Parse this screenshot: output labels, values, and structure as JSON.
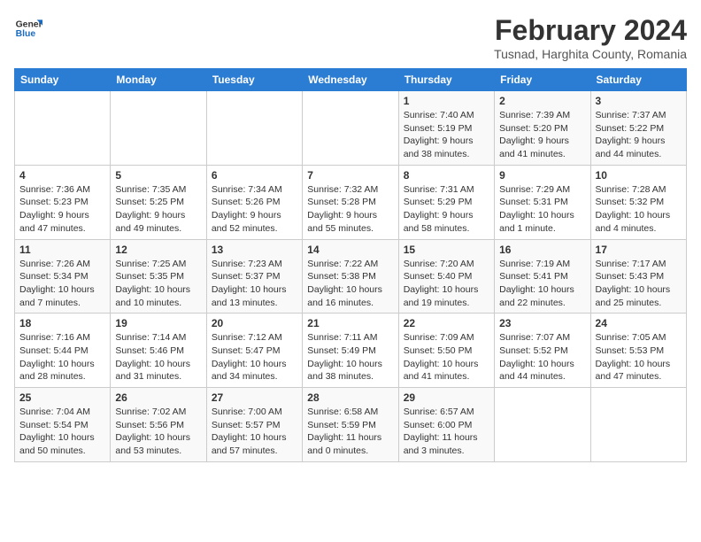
{
  "header": {
    "logo_line1": "General",
    "logo_line2": "Blue",
    "title": "February 2024",
    "subtitle": "Tusnad, Harghita County, Romania"
  },
  "weekdays": [
    "Sunday",
    "Monday",
    "Tuesday",
    "Wednesday",
    "Thursday",
    "Friday",
    "Saturday"
  ],
  "weeks": [
    [
      {
        "day": "",
        "info": ""
      },
      {
        "day": "",
        "info": ""
      },
      {
        "day": "",
        "info": ""
      },
      {
        "day": "",
        "info": ""
      },
      {
        "day": "1",
        "info": "Sunrise: 7:40 AM\nSunset: 5:19 PM\nDaylight: 9 hours\nand 38 minutes."
      },
      {
        "day": "2",
        "info": "Sunrise: 7:39 AM\nSunset: 5:20 PM\nDaylight: 9 hours\nand 41 minutes."
      },
      {
        "day": "3",
        "info": "Sunrise: 7:37 AM\nSunset: 5:22 PM\nDaylight: 9 hours\nand 44 minutes."
      }
    ],
    [
      {
        "day": "4",
        "info": "Sunrise: 7:36 AM\nSunset: 5:23 PM\nDaylight: 9 hours\nand 47 minutes."
      },
      {
        "day": "5",
        "info": "Sunrise: 7:35 AM\nSunset: 5:25 PM\nDaylight: 9 hours\nand 49 minutes."
      },
      {
        "day": "6",
        "info": "Sunrise: 7:34 AM\nSunset: 5:26 PM\nDaylight: 9 hours\nand 52 minutes."
      },
      {
        "day": "7",
        "info": "Sunrise: 7:32 AM\nSunset: 5:28 PM\nDaylight: 9 hours\nand 55 minutes."
      },
      {
        "day": "8",
        "info": "Sunrise: 7:31 AM\nSunset: 5:29 PM\nDaylight: 9 hours\nand 58 minutes."
      },
      {
        "day": "9",
        "info": "Sunrise: 7:29 AM\nSunset: 5:31 PM\nDaylight: 10 hours\nand 1 minute."
      },
      {
        "day": "10",
        "info": "Sunrise: 7:28 AM\nSunset: 5:32 PM\nDaylight: 10 hours\nand 4 minutes."
      }
    ],
    [
      {
        "day": "11",
        "info": "Sunrise: 7:26 AM\nSunset: 5:34 PM\nDaylight: 10 hours\nand 7 minutes."
      },
      {
        "day": "12",
        "info": "Sunrise: 7:25 AM\nSunset: 5:35 PM\nDaylight: 10 hours\nand 10 minutes."
      },
      {
        "day": "13",
        "info": "Sunrise: 7:23 AM\nSunset: 5:37 PM\nDaylight: 10 hours\nand 13 minutes."
      },
      {
        "day": "14",
        "info": "Sunrise: 7:22 AM\nSunset: 5:38 PM\nDaylight: 10 hours\nand 16 minutes."
      },
      {
        "day": "15",
        "info": "Sunrise: 7:20 AM\nSunset: 5:40 PM\nDaylight: 10 hours\nand 19 minutes."
      },
      {
        "day": "16",
        "info": "Sunrise: 7:19 AM\nSunset: 5:41 PM\nDaylight: 10 hours\nand 22 minutes."
      },
      {
        "day": "17",
        "info": "Sunrise: 7:17 AM\nSunset: 5:43 PM\nDaylight: 10 hours\nand 25 minutes."
      }
    ],
    [
      {
        "day": "18",
        "info": "Sunrise: 7:16 AM\nSunset: 5:44 PM\nDaylight: 10 hours\nand 28 minutes."
      },
      {
        "day": "19",
        "info": "Sunrise: 7:14 AM\nSunset: 5:46 PM\nDaylight: 10 hours\nand 31 minutes."
      },
      {
        "day": "20",
        "info": "Sunrise: 7:12 AM\nSunset: 5:47 PM\nDaylight: 10 hours\nand 34 minutes."
      },
      {
        "day": "21",
        "info": "Sunrise: 7:11 AM\nSunset: 5:49 PM\nDaylight: 10 hours\nand 38 minutes."
      },
      {
        "day": "22",
        "info": "Sunrise: 7:09 AM\nSunset: 5:50 PM\nDaylight: 10 hours\nand 41 minutes."
      },
      {
        "day": "23",
        "info": "Sunrise: 7:07 AM\nSunset: 5:52 PM\nDaylight: 10 hours\nand 44 minutes."
      },
      {
        "day": "24",
        "info": "Sunrise: 7:05 AM\nSunset: 5:53 PM\nDaylight: 10 hours\nand 47 minutes."
      }
    ],
    [
      {
        "day": "25",
        "info": "Sunrise: 7:04 AM\nSunset: 5:54 PM\nDaylight: 10 hours\nand 50 minutes."
      },
      {
        "day": "26",
        "info": "Sunrise: 7:02 AM\nSunset: 5:56 PM\nDaylight: 10 hours\nand 53 minutes."
      },
      {
        "day": "27",
        "info": "Sunrise: 7:00 AM\nSunset: 5:57 PM\nDaylight: 10 hours\nand 57 minutes."
      },
      {
        "day": "28",
        "info": "Sunrise: 6:58 AM\nSunset: 5:59 PM\nDaylight: 11 hours\nand 0 minutes."
      },
      {
        "day": "29",
        "info": "Sunrise: 6:57 AM\nSunset: 6:00 PM\nDaylight: 11 hours\nand 3 minutes."
      },
      {
        "day": "",
        "info": ""
      },
      {
        "day": "",
        "info": ""
      }
    ]
  ]
}
